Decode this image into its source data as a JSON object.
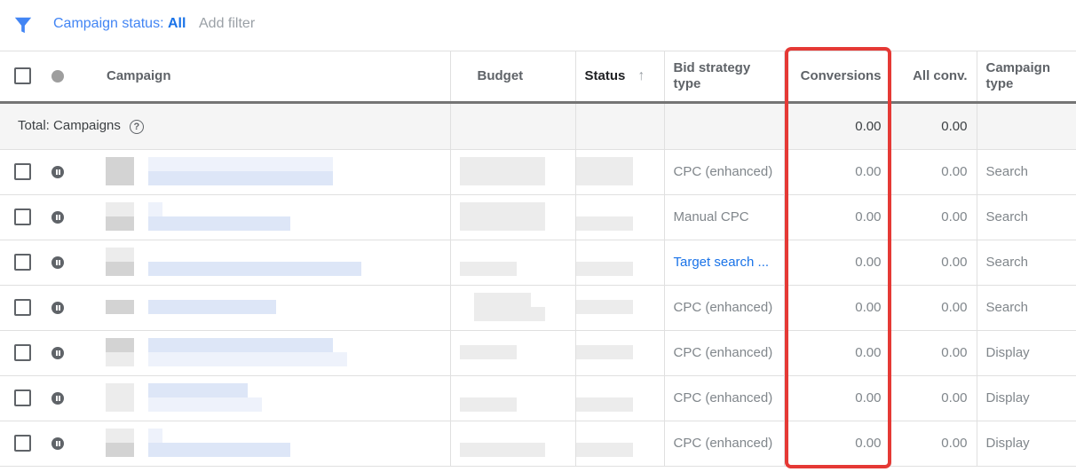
{
  "filter_bar": {
    "icon": "filter-icon",
    "status_label": "Campaign status:",
    "status_value": "All",
    "add_filter_label": "Add filter"
  },
  "table": {
    "columns": {
      "select_all": "checkbox",
      "status_dot": "status-dot",
      "campaign": "Campaign",
      "budget": "Budget",
      "status": "Status",
      "status_sort_icon": "arrow-up-icon",
      "bid_strategy_type": "Bid strategy type",
      "conversions": "Conversions",
      "all_conv": "All conv.",
      "campaign_type": "Campaign type"
    },
    "total_row": {
      "label": "Total: Campaigns",
      "help_icon": "?",
      "conversions": "0.00",
      "all_conv": "0.00"
    },
    "rows": [
      {
        "status_icon": "pause-icon",
        "bid_strategy_type": "CPC (enhanced)",
        "bid_link": false,
        "conversions": "0.00",
        "all_conv": "0.00",
        "campaign_type": "Search"
      },
      {
        "status_icon": "pause-icon",
        "bid_strategy_type": "Manual CPC",
        "bid_link": false,
        "conversions": "0.00",
        "all_conv": "0.00",
        "campaign_type": "Search"
      },
      {
        "status_icon": "pause-icon",
        "bid_strategy_type": "Target search ...",
        "bid_link": true,
        "conversions": "0.00",
        "all_conv": "0.00",
        "campaign_type": "Search"
      },
      {
        "status_icon": "pause-icon",
        "bid_strategy_type": "CPC (enhanced)",
        "bid_link": false,
        "conversions": "0.00",
        "all_conv": "0.00",
        "campaign_type": "Search"
      },
      {
        "status_icon": "pause-icon",
        "bid_strategy_type": "CPC (enhanced)",
        "bid_link": false,
        "conversions": "0.00",
        "all_conv": "0.00",
        "campaign_type": "Display"
      },
      {
        "status_icon": "pause-icon",
        "bid_strategy_type": "CPC (enhanced)",
        "bid_link": false,
        "conversions": "0.00",
        "all_conv": "0.00",
        "campaign_type": "Display"
      },
      {
        "status_icon": "pause-icon",
        "bid_strategy_type": "CPC (enhanced)",
        "bid_link": false,
        "conversions": "0.00",
        "all_conv": "0.00",
        "campaign_type": "Display"
      }
    ]
  },
  "highlight": {
    "target_column": "Conversions",
    "color": "#e53935"
  },
  "colors": {
    "accent": "#1a73e8",
    "link": "#1a73e8",
    "filter_text": "#4285f4"
  }
}
